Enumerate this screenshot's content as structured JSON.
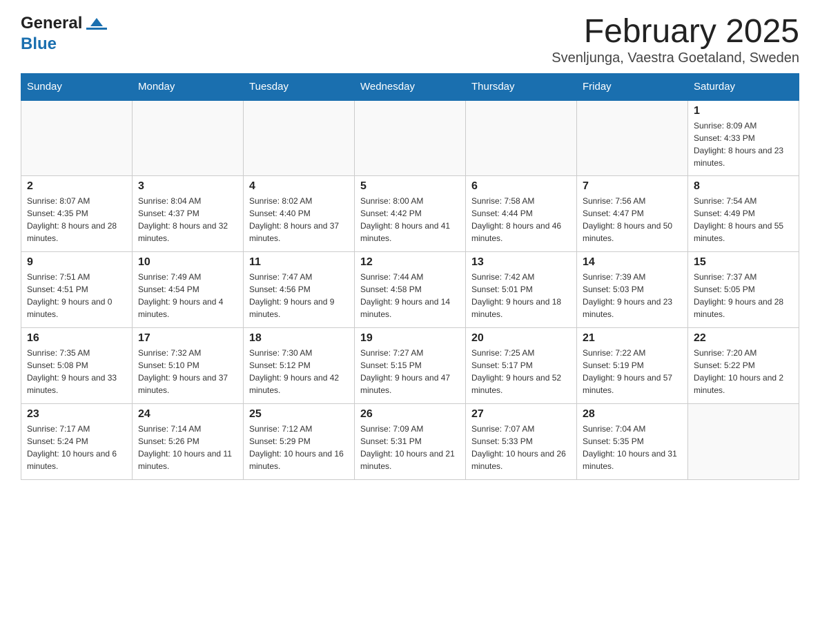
{
  "header": {
    "logo": {
      "general": "General",
      "blue": "Blue"
    },
    "title": "February 2025",
    "subtitle": "Svenljunga, Vaestra Goetaland, Sweden"
  },
  "calendar": {
    "days": [
      "Sunday",
      "Monday",
      "Tuesday",
      "Wednesday",
      "Thursday",
      "Friday",
      "Saturday"
    ],
    "weeks": [
      [
        {
          "day": "",
          "info": ""
        },
        {
          "day": "",
          "info": ""
        },
        {
          "day": "",
          "info": ""
        },
        {
          "day": "",
          "info": ""
        },
        {
          "day": "",
          "info": ""
        },
        {
          "day": "",
          "info": ""
        },
        {
          "day": "1",
          "info": "Sunrise: 8:09 AM\nSunset: 4:33 PM\nDaylight: 8 hours and 23 minutes."
        }
      ],
      [
        {
          "day": "2",
          "info": "Sunrise: 8:07 AM\nSunset: 4:35 PM\nDaylight: 8 hours and 28 minutes."
        },
        {
          "day": "3",
          "info": "Sunrise: 8:04 AM\nSunset: 4:37 PM\nDaylight: 8 hours and 32 minutes."
        },
        {
          "day": "4",
          "info": "Sunrise: 8:02 AM\nSunset: 4:40 PM\nDaylight: 8 hours and 37 minutes."
        },
        {
          "day": "5",
          "info": "Sunrise: 8:00 AM\nSunset: 4:42 PM\nDaylight: 8 hours and 41 minutes."
        },
        {
          "day": "6",
          "info": "Sunrise: 7:58 AM\nSunset: 4:44 PM\nDaylight: 8 hours and 46 minutes."
        },
        {
          "day": "7",
          "info": "Sunrise: 7:56 AM\nSunset: 4:47 PM\nDaylight: 8 hours and 50 minutes."
        },
        {
          "day": "8",
          "info": "Sunrise: 7:54 AM\nSunset: 4:49 PM\nDaylight: 8 hours and 55 minutes."
        }
      ],
      [
        {
          "day": "9",
          "info": "Sunrise: 7:51 AM\nSunset: 4:51 PM\nDaylight: 9 hours and 0 minutes."
        },
        {
          "day": "10",
          "info": "Sunrise: 7:49 AM\nSunset: 4:54 PM\nDaylight: 9 hours and 4 minutes."
        },
        {
          "day": "11",
          "info": "Sunrise: 7:47 AM\nSunset: 4:56 PM\nDaylight: 9 hours and 9 minutes."
        },
        {
          "day": "12",
          "info": "Sunrise: 7:44 AM\nSunset: 4:58 PM\nDaylight: 9 hours and 14 minutes."
        },
        {
          "day": "13",
          "info": "Sunrise: 7:42 AM\nSunset: 5:01 PM\nDaylight: 9 hours and 18 minutes."
        },
        {
          "day": "14",
          "info": "Sunrise: 7:39 AM\nSunset: 5:03 PM\nDaylight: 9 hours and 23 minutes."
        },
        {
          "day": "15",
          "info": "Sunrise: 7:37 AM\nSunset: 5:05 PM\nDaylight: 9 hours and 28 minutes."
        }
      ],
      [
        {
          "day": "16",
          "info": "Sunrise: 7:35 AM\nSunset: 5:08 PM\nDaylight: 9 hours and 33 minutes."
        },
        {
          "day": "17",
          "info": "Sunrise: 7:32 AM\nSunset: 5:10 PM\nDaylight: 9 hours and 37 minutes."
        },
        {
          "day": "18",
          "info": "Sunrise: 7:30 AM\nSunset: 5:12 PM\nDaylight: 9 hours and 42 minutes."
        },
        {
          "day": "19",
          "info": "Sunrise: 7:27 AM\nSunset: 5:15 PM\nDaylight: 9 hours and 47 minutes."
        },
        {
          "day": "20",
          "info": "Sunrise: 7:25 AM\nSunset: 5:17 PM\nDaylight: 9 hours and 52 minutes."
        },
        {
          "day": "21",
          "info": "Sunrise: 7:22 AM\nSunset: 5:19 PM\nDaylight: 9 hours and 57 minutes."
        },
        {
          "day": "22",
          "info": "Sunrise: 7:20 AM\nSunset: 5:22 PM\nDaylight: 10 hours and 2 minutes."
        }
      ],
      [
        {
          "day": "23",
          "info": "Sunrise: 7:17 AM\nSunset: 5:24 PM\nDaylight: 10 hours and 6 minutes."
        },
        {
          "day": "24",
          "info": "Sunrise: 7:14 AM\nSunset: 5:26 PM\nDaylight: 10 hours and 11 minutes."
        },
        {
          "day": "25",
          "info": "Sunrise: 7:12 AM\nSunset: 5:29 PM\nDaylight: 10 hours and 16 minutes."
        },
        {
          "day": "26",
          "info": "Sunrise: 7:09 AM\nSunset: 5:31 PM\nDaylight: 10 hours and 21 minutes."
        },
        {
          "day": "27",
          "info": "Sunrise: 7:07 AM\nSunset: 5:33 PM\nDaylight: 10 hours and 26 minutes."
        },
        {
          "day": "28",
          "info": "Sunrise: 7:04 AM\nSunset: 5:35 PM\nDaylight: 10 hours and 31 minutes."
        },
        {
          "day": "",
          "info": ""
        }
      ]
    ]
  }
}
